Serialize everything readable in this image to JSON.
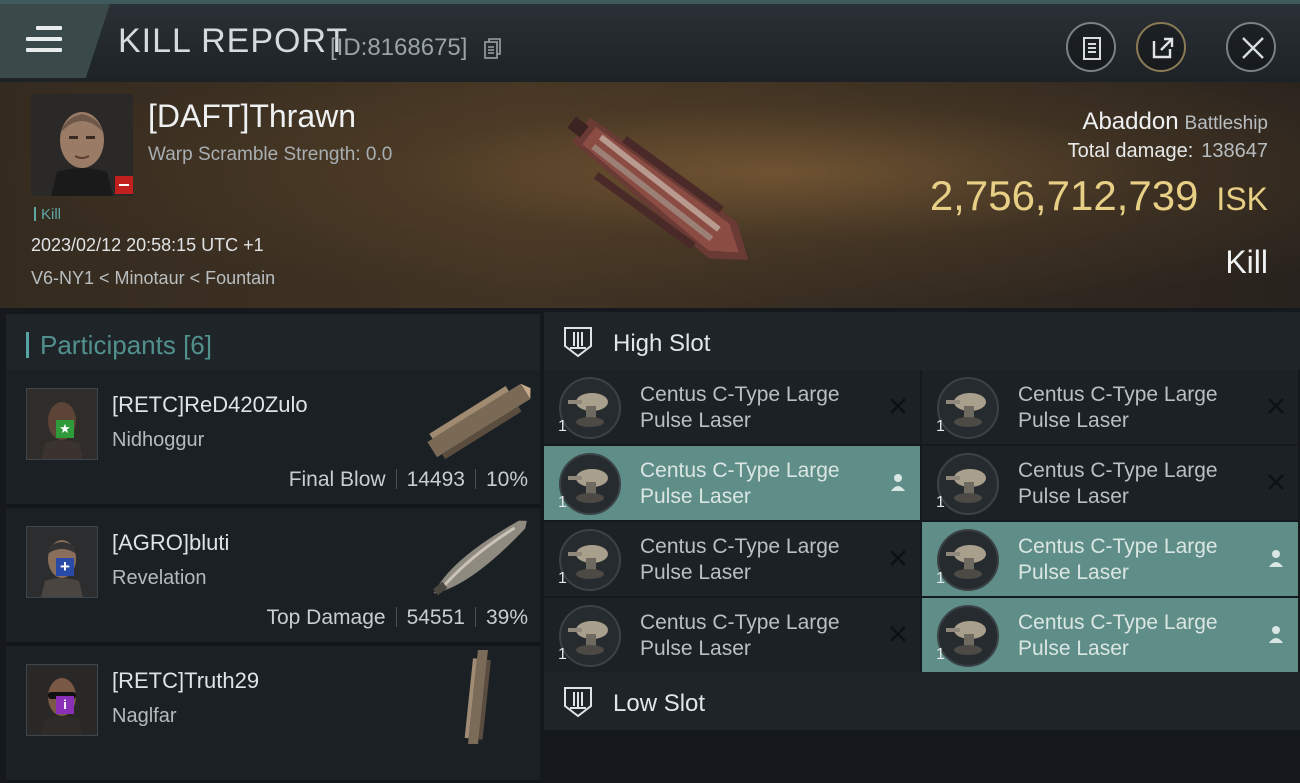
{
  "header": {
    "title": "KILL REPORT",
    "report_id": "[ID:8168675]",
    "icons": [
      "menu-icon",
      "copy-icon",
      "clipboard-icon",
      "share-icon",
      "close-icon"
    ]
  },
  "victim": {
    "name": "[DAFT]Thrawn",
    "warp_scramble": "Warp Scramble Strength: 0.0",
    "kill_label": "Kill",
    "datetime": "2023/02/12 20:58:15 UTC +1",
    "location": "V6-NY1 < Minotaur < Fountain",
    "ship_name": "Abaddon",
    "ship_class": "Battleship",
    "total_damage_label": "Total damage:",
    "total_damage": "138647",
    "isk_value": "2,756,712,739",
    "isk_unit": "ISK",
    "result": "Kill"
  },
  "participants": {
    "label": "Participants",
    "count": "[6]",
    "list": [
      {
        "name": "[RETC]ReD420Zulo",
        "ship": "Nidhoggur",
        "role": "Final Blow",
        "damage": "14493",
        "percent": "10%",
        "badge": "star"
      },
      {
        "name": "[AGRO]bluti",
        "ship": "Revelation",
        "role": "Top Damage",
        "damage": "54551",
        "percent": "39%",
        "badge": "plus"
      },
      {
        "name": "[RETC]Truth29",
        "ship": "Naglfar",
        "role": "",
        "damage": "",
        "percent": "",
        "badge": "info"
      }
    ]
  },
  "fitting": {
    "high_slot_label": "High Slot",
    "low_slot_label": "Low Slot",
    "module_line1": "Centus C-Type Large",
    "module_line2": "Pulse Laser",
    "quantity": "1",
    "modules": [
      {
        "state": "destroyed"
      },
      {
        "state": "destroyed"
      },
      {
        "state": "dropped"
      },
      {
        "state": "destroyed"
      },
      {
        "state": "destroyed"
      },
      {
        "state": "dropped"
      },
      {
        "state": "destroyed"
      },
      {
        "state": "dropped"
      }
    ]
  },
  "colors": {
    "accent_teal": "#5ea7a6",
    "isk_gold": "#e8cf86",
    "dropped_bg": "#5e8e87",
    "security_red": "#c2201e"
  }
}
